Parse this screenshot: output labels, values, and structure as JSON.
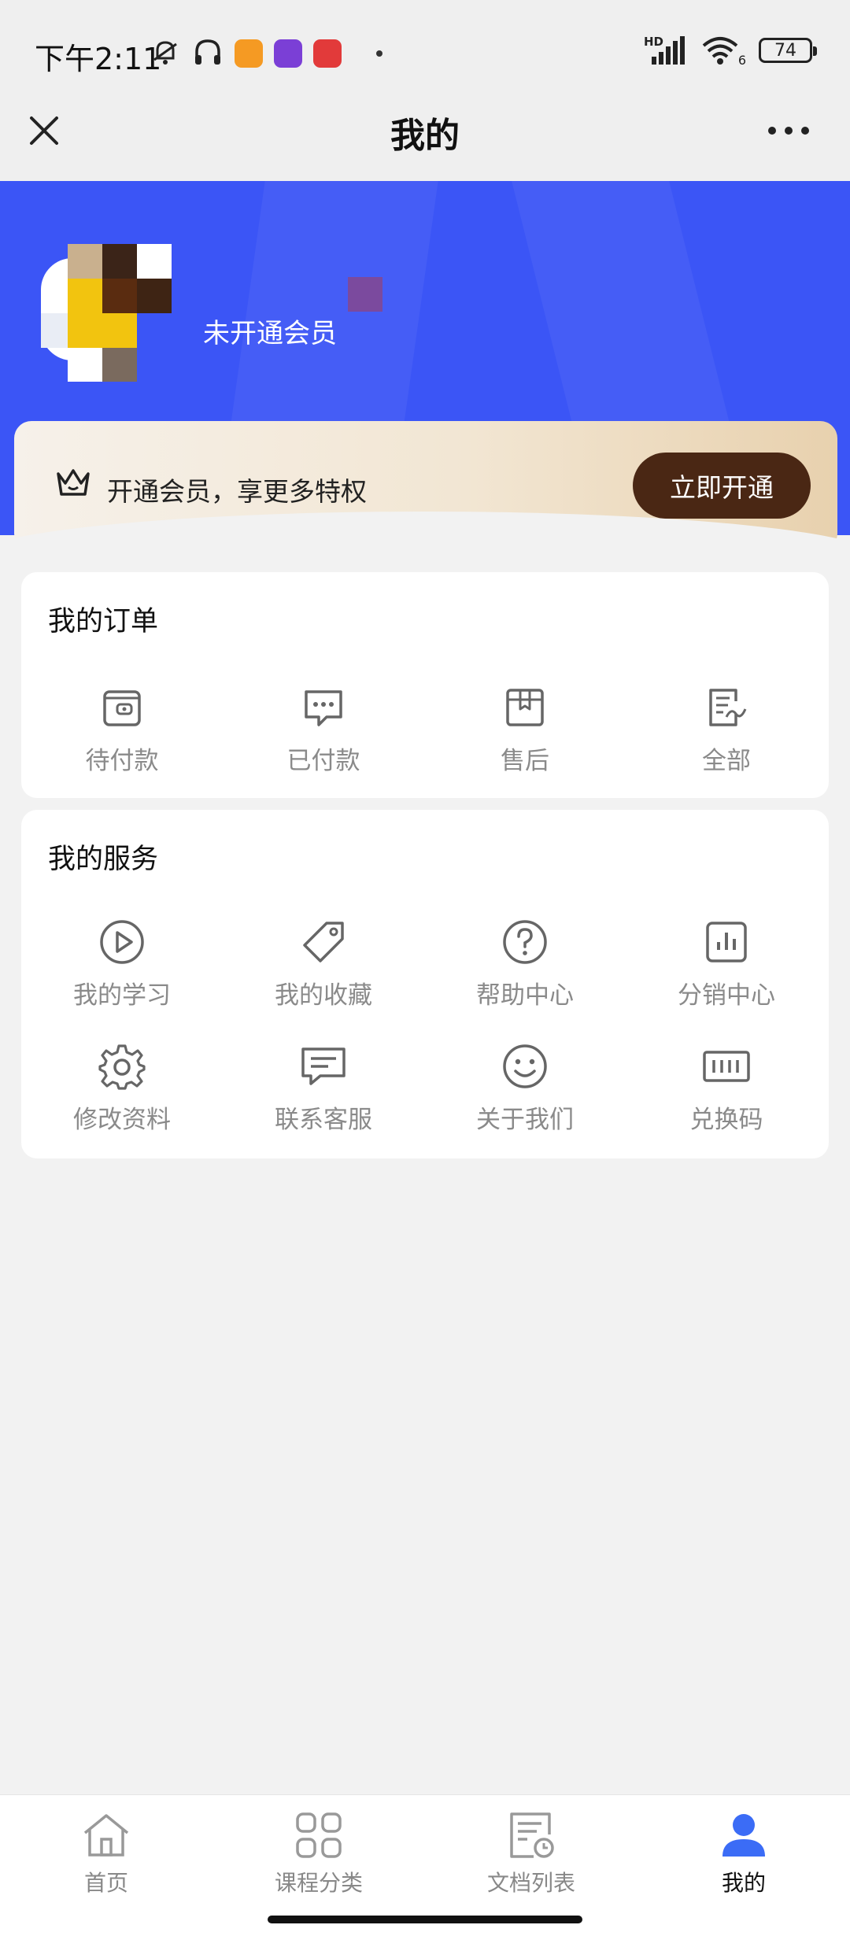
{
  "status_bar": {
    "time": "下午2:11",
    "network_badge": "HD",
    "signal_suffix": "6",
    "battery": "74"
  },
  "header": {
    "title": "我的"
  },
  "profile": {
    "member_status": "未开通会员"
  },
  "vip": {
    "promo_text": "开通会员，享更多特权",
    "open_button": "立即开通"
  },
  "orders": {
    "title": "我的订单",
    "items": [
      {
        "label": "待付款",
        "icon": "wallet-icon"
      },
      {
        "label": "已付款",
        "icon": "chat-dots-icon"
      },
      {
        "label": "售后",
        "icon": "package-icon"
      },
      {
        "label": "全部",
        "icon": "document-list-icon"
      }
    ]
  },
  "services": {
    "title": "我的服务",
    "items": [
      {
        "label": "我的学习",
        "icon": "play-circle-icon"
      },
      {
        "label": "我的收藏",
        "icon": "tag-icon"
      },
      {
        "label": "帮助中心",
        "icon": "question-circle-icon"
      },
      {
        "label": "分销中心",
        "icon": "bar-chart-icon"
      },
      {
        "label": "修改资料",
        "icon": "gear-icon"
      },
      {
        "label": "联系客服",
        "icon": "message-icon"
      },
      {
        "label": "关于我们",
        "icon": "smile-icon"
      },
      {
        "label": "兑换码",
        "icon": "barcode-icon"
      }
    ]
  },
  "tab_bar": {
    "items": [
      {
        "label": "首页",
        "icon": "home-icon",
        "active": false
      },
      {
        "label": "课程分类",
        "icon": "grid-icon",
        "active": false
      },
      {
        "label": "文档列表",
        "icon": "document-clock-icon",
        "active": false
      },
      {
        "label": "我的",
        "icon": "user-icon",
        "active": true
      }
    ]
  },
  "colors": {
    "brand_blue": "#3b55f6",
    "vip_button": "#4a2714",
    "active_tab": "#3b6cf6",
    "icon_gray": "#666666",
    "label_gray": "#8a8a8a"
  }
}
